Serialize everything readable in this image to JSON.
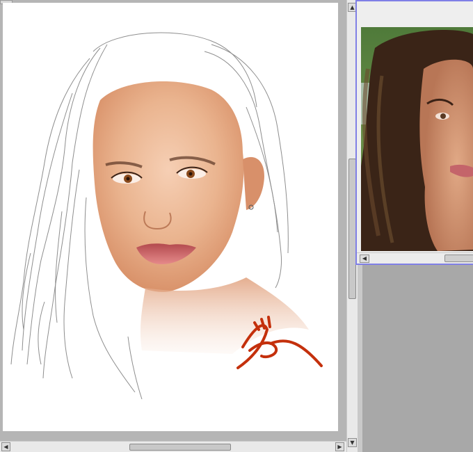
{
  "canvas_window": {
    "artwork": "portrait-sketch",
    "signature_color": "#c4300c"
  },
  "reference_window": {
    "photo": "reference-portrait-photo",
    "border_color": "#7f7fe6"
  },
  "icons": {
    "scroll_up": "▲",
    "scroll_down": "▼",
    "scroll_left": "◀",
    "scroll_right": "▶"
  }
}
